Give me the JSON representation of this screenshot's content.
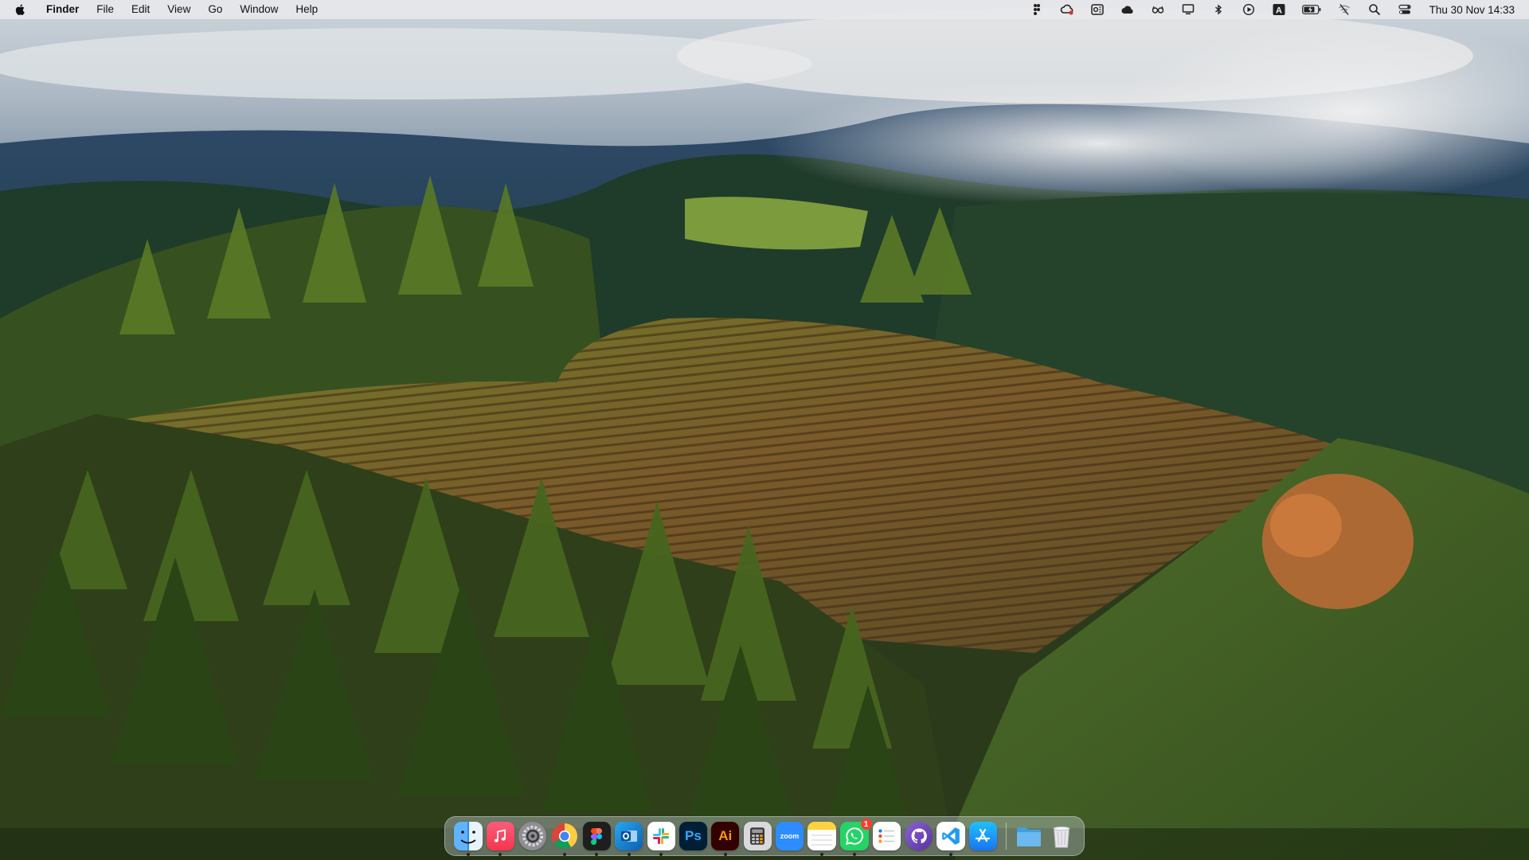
{
  "menubar": {
    "app_name": "Finder",
    "menus": [
      "File",
      "Edit",
      "View",
      "Go",
      "Window",
      "Help"
    ],
    "status_icons": [
      "figma-menu-icon",
      "creative-cloud-icon",
      "outlook-icon",
      "icloud-icon",
      "glasses-icon",
      "display-icon",
      "bluetooth-icon",
      "play-icon",
      "input-source-icon",
      "battery-icon",
      "wifi-off-icon",
      "spotlight-search-icon",
      "control-center-icon"
    ],
    "input_source_label": "A",
    "clock": "Thu 30 Nov  14:33"
  },
  "dock": {
    "apps": [
      {
        "name": "Finder",
        "icon": "finder-icon",
        "color": "#2f8bf0",
        "running": true
      },
      {
        "name": "Music",
        "icon": "music-icon",
        "color": "#fb3c54",
        "running": true
      },
      {
        "name": "System Settings",
        "icon": "gear-icon",
        "color": "#8e8e93",
        "running": false
      },
      {
        "name": "Chrome",
        "icon": "chrome-icon",
        "color": "#ffffff",
        "running": true
      },
      {
        "name": "Figma",
        "icon": "figma-icon",
        "color": "#1e1e1e",
        "running": true
      },
      {
        "name": "Outlook",
        "icon": "outlook-icon",
        "color": "#0f6cbd",
        "running": true
      },
      {
        "name": "Slack",
        "icon": "slack-icon",
        "color": "#ffffff",
        "running": true
      },
      {
        "name": "Photoshop",
        "icon": "photoshop-icon",
        "color": "#001e36",
        "label": "Ps",
        "running": false
      },
      {
        "name": "Illustrator",
        "icon": "illustrator-icon",
        "color": "#330000",
        "label": "Ai",
        "running": true
      },
      {
        "name": "Calculator",
        "icon": "calculator-icon",
        "color": "#3a3a3c",
        "running": false
      },
      {
        "name": "Zoom",
        "icon": "zoom-icon",
        "color": "#2d8cff",
        "label": "zoom",
        "running": false
      },
      {
        "name": "Notes",
        "icon": "notes-icon",
        "color": "#fefefe",
        "running": true
      },
      {
        "name": "WhatsApp",
        "icon": "whatsapp-icon",
        "color": "#25d366",
        "badge": "1",
        "running": true
      },
      {
        "name": "Reminders",
        "icon": "reminders-icon",
        "color": "#ffffff",
        "running": false
      },
      {
        "name": "GitHub Desktop",
        "icon": "github-icon",
        "color": "#6e40c9",
        "running": false
      },
      {
        "name": "Visual Studio Code",
        "icon": "vscode-icon",
        "color": "#1f9cf0",
        "running": true
      },
      {
        "name": "App Store",
        "icon": "app-store-icon",
        "color": "#1e88f5",
        "running": false
      }
    ],
    "folders": [
      {
        "name": "Downloads",
        "icon": "folder-icon",
        "color": "#6bb9f0"
      },
      {
        "name": "Trash",
        "icon": "trash-icon",
        "color": "#e6e6ea"
      }
    ]
  }
}
